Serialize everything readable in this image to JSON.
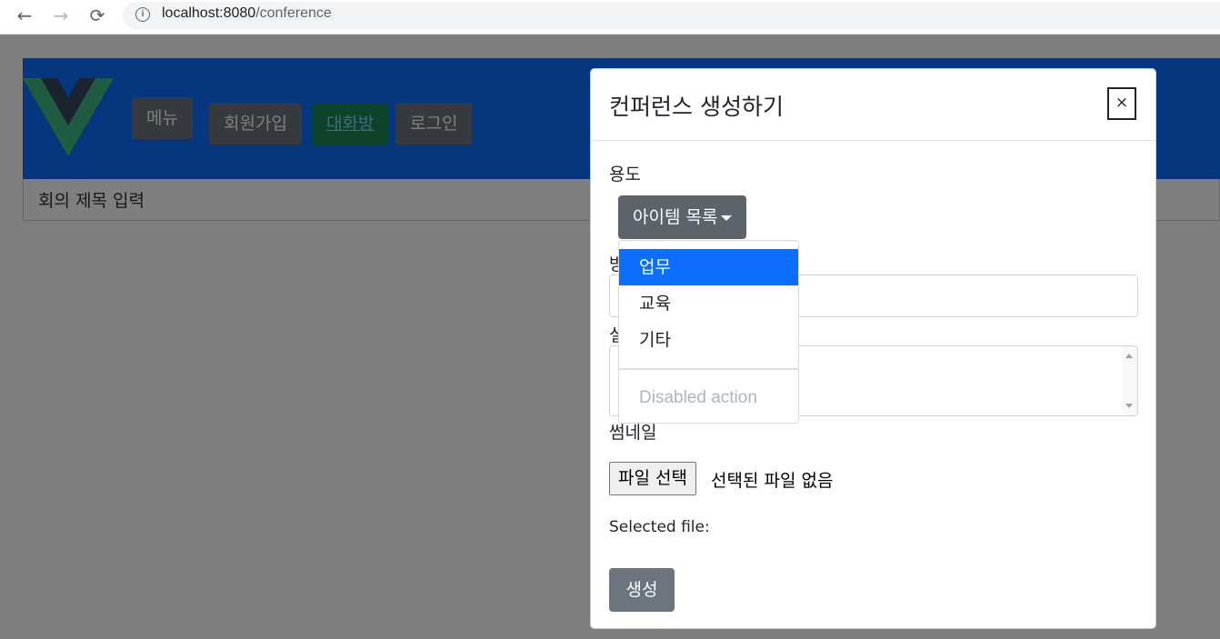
{
  "browser": {
    "url_host": "localhost:8080",
    "url_path": "/conference",
    "back_icon": "←",
    "forward_icon": "→",
    "reload_icon": "⟳",
    "info_icon": "i"
  },
  "header": {
    "nav": {
      "menu": "메뉴",
      "signup": "회원가입",
      "conference": "대화방",
      "login": "로그인"
    }
  },
  "subbar": {
    "placeholder": "회의 제목 입력"
  },
  "modal": {
    "title": "컨퍼런스 생성하기",
    "close": "×",
    "purpose_label": "용도",
    "dropdown_label": "아이템 목록",
    "options": [
      "업무",
      "교육",
      "기타"
    ],
    "disabled_option": "Disabled action",
    "name_label": "방",
    "desc_label": "설",
    "thumbnail_label": "썸네일",
    "file_button": "파일 선택",
    "file_status": "선택된 파일 없음",
    "selected_file": "Selected file:",
    "create_button": "생성"
  },
  "colors": {
    "header_bg": "#0d6efd",
    "active_item": "#0d6efd",
    "secondary_btn": "#6c757d",
    "green_btn": "#198754"
  }
}
